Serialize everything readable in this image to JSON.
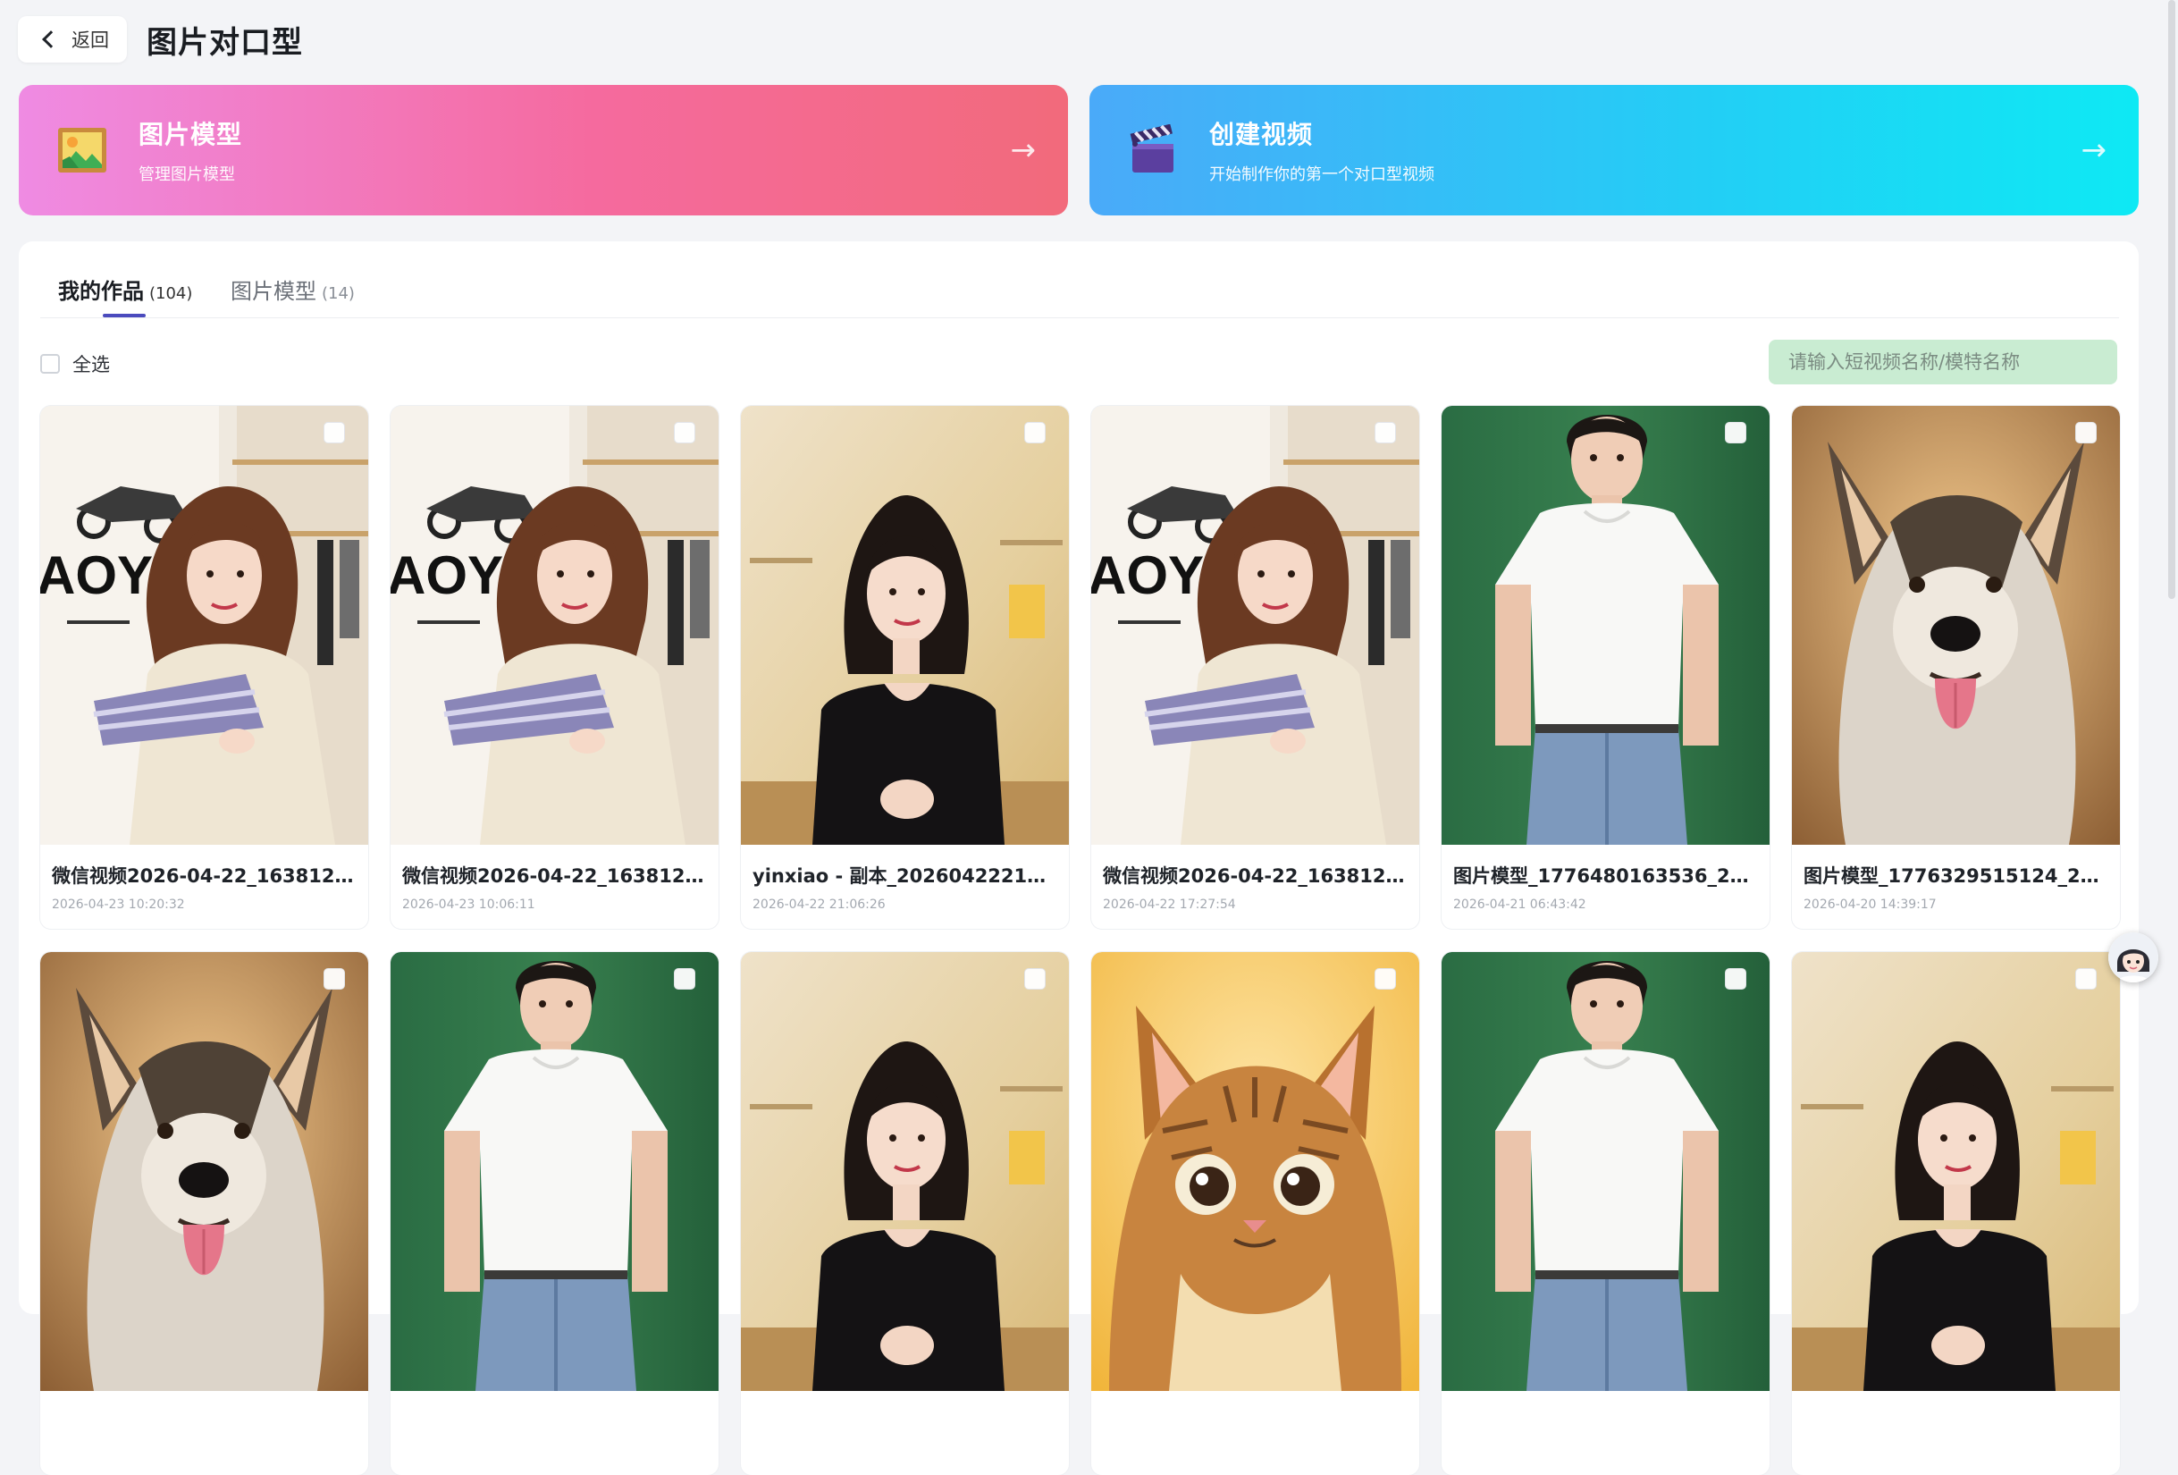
{
  "header": {
    "back_label": "返回",
    "title": "图片对口型"
  },
  "hero": {
    "image_model": {
      "title": "图片模型",
      "subtitle": "管理图片模型",
      "icon": "framed-picture-icon",
      "arrow": "→"
    },
    "create_video": {
      "title": "创建视频",
      "subtitle": "开始制作你的第一个对口型视频",
      "icon": "clapper-board-icon",
      "arrow": "→"
    }
  },
  "tabs": [
    {
      "label": "我的作品",
      "count": "(104)",
      "active": true
    },
    {
      "label": "图片模型",
      "count": "(14)",
      "active": false
    }
  ],
  "toolbar": {
    "select_all_label": "全选",
    "search_placeholder": "请输入短视频名称/模特名称"
  },
  "cards": [
    {
      "name": "微信视频2026-04-22_163812_0…",
      "date": "2026-04-23 10:20:32",
      "thumb": "woman-shop"
    },
    {
      "name": "微信视频2026-04-22_163812_0…",
      "date": "2026-04-23 10:06:11",
      "thumb": "woman-shop"
    },
    {
      "name": "yinxiao - 副本_20260422210626",
      "date": "2026-04-22 21:06:26",
      "thumb": "woman-black"
    },
    {
      "name": "微信视频2026-04-22_163812_0…",
      "date": "2026-04-22 17:27:54",
      "thumb": "woman-shop"
    },
    {
      "name": "图片模型_1776480163536_2026…",
      "date": "2026-04-21 06:43:42",
      "thumb": "man-white"
    },
    {
      "name": "图片模型_1776329515124_2026…",
      "date": "2026-04-20 14:39:17",
      "thumb": "dog"
    },
    {
      "name": "",
      "date": "",
      "thumb": "dog"
    },
    {
      "name": "",
      "date": "",
      "thumb": "man-white"
    },
    {
      "name": "",
      "date": "",
      "thumb": "woman-black"
    },
    {
      "name": "",
      "date": "",
      "thumb": "cat"
    },
    {
      "name": "",
      "date": "",
      "thumb": "man-white"
    },
    {
      "name": "",
      "date": "",
      "thumb": "woman-black"
    }
  ],
  "colors": {
    "accent": "#4b4bbd",
    "hero_left_start": "#ef8be3",
    "hero_left_end": "#f26a7b",
    "hero_right_start": "#4aaaf9",
    "hero_right_end": "#0ee9f4",
    "search_bg": "#c9ecd2"
  }
}
